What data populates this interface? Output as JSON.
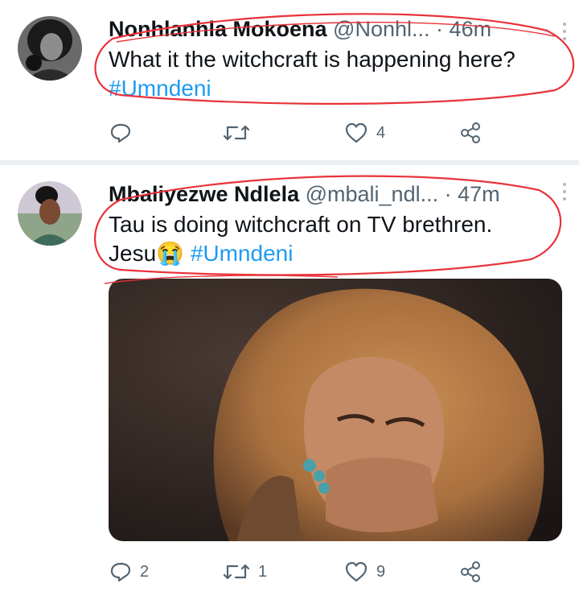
{
  "tweets": [
    {
      "name": "Nonhlanhla Mokoena",
      "handle": "@Nonhl...",
      "dot": "·",
      "time": "46m",
      "text": "What it the witchcraft is happening here?",
      "hashtag": "#Umndeni",
      "counts": {
        "reply": "",
        "retweet": "",
        "like": "4"
      }
    },
    {
      "name": "Mbaliyezwe Ndlela",
      "handle": "@mbali_ndl...",
      "dot": "·",
      "time": "47m",
      "text": "Tau is doing witchcraft on TV brethren.",
      "text2": "Jesu",
      "emoji": "😭",
      "hashtag": "#Umndeni",
      "counts": {
        "reply": "2",
        "retweet": "1",
        "like": "9"
      }
    }
  ],
  "colors": {
    "link": "#1d9bf0",
    "secondary": "#536471",
    "annotation": "#e8333a"
  },
  "icons": [
    "reply-icon",
    "retweet-icon",
    "like-icon",
    "share-icon",
    "more-icon"
  ]
}
